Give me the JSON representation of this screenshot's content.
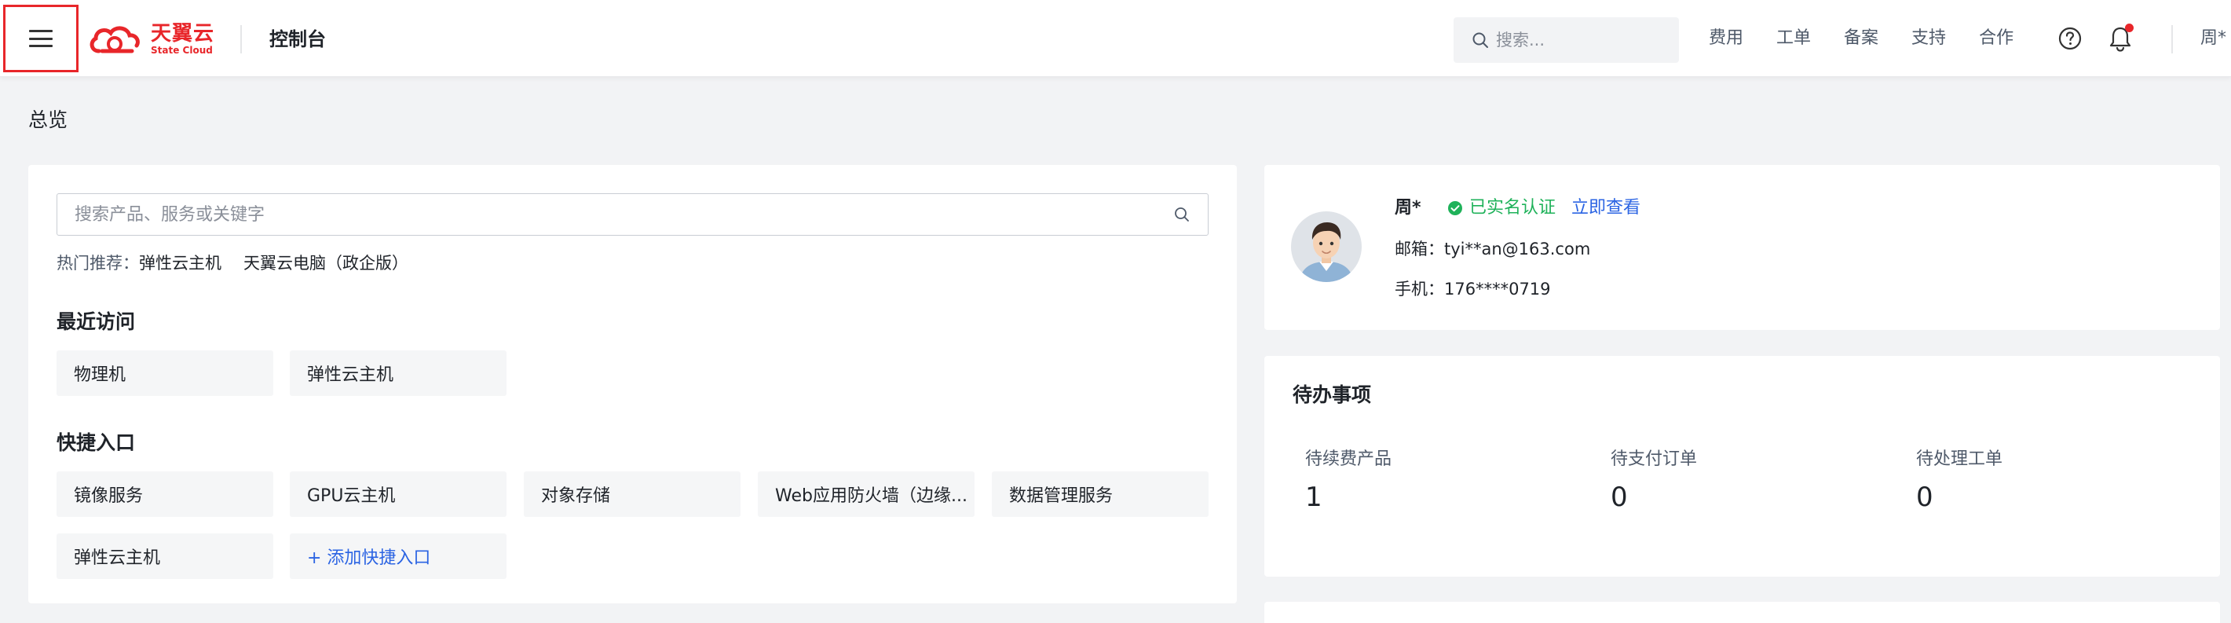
{
  "header": {
    "logo_cn": "天翼云",
    "logo_en": "State Cloud",
    "console_title": "控制台",
    "search_placeholder": "搜索...",
    "nav": [
      "费用",
      "工单",
      "备案",
      "支持",
      "合作"
    ],
    "user": "周*"
  },
  "page": {
    "title": "总览"
  },
  "search": {
    "placeholder": "搜索产品、服务或关键字",
    "hot_label": "热门推荐：",
    "hot_items": [
      "弹性云主机",
      "天翼云电脑（政企版）"
    ]
  },
  "recent": {
    "title": "最近访问",
    "items": [
      "物理机",
      "弹性云主机"
    ]
  },
  "shortcuts": {
    "title": "快捷入口",
    "items": [
      "镜像服务",
      "GPU云主机",
      "对象存储",
      "Web应用防火墙（边缘...",
      "数据管理服务",
      "弹性云主机"
    ],
    "add_label": "+ 添加快捷入口"
  },
  "profile": {
    "name": "周*",
    "verified_label": "已实名认证",
    "view_label": "立即查看",
    "email": "邮箱：tyi**an@163.com",
    "phone": "手机：176****0719"
  },
  "todo": {
    "title": "待办事项",
    "items": [
      {
        "label": "待续费产品",
        "value": "1"
      },
      {
        "label": "待支付订单",
        "value": "0"
      },
      {
        "label": "待处理工单",
        "value": "0"
      }
    ]
  },
  "colors": {
    "brand": "#e8262a",
    "link": "#2b64e3",
    "success": "#1fb25a",
    "background": "#f2f3f5"
  }
}
